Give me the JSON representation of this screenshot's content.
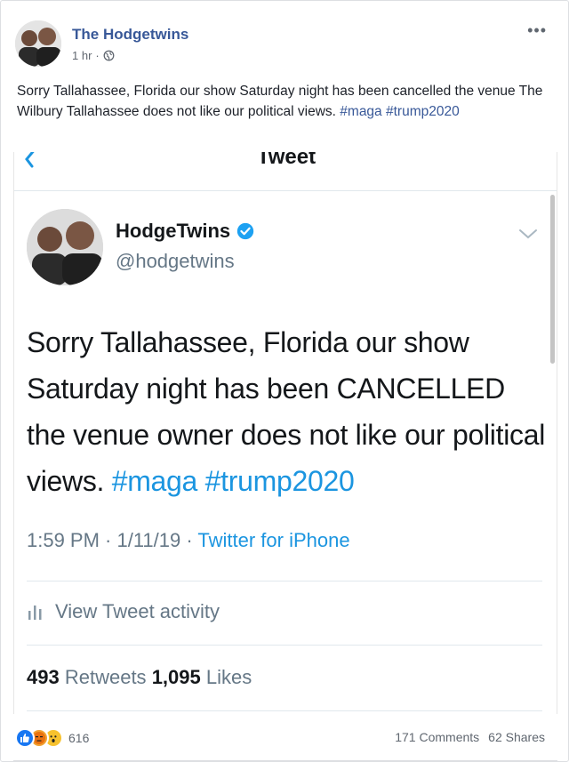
{
  "post": {
    "page_name": "The Hodgetwins",
    "time": "1 hr",
    "separator": "·",
    "more_label": "•••",
    "caption_text": "Sorry Tallahassee, Florida our show Saturday night has been cancelled the venue The Wilbury Tallahassee does not like our political views.",
    "caption_tags": [
      "#maga",
      "#trump2020"
    ]
  },
  "tweet": {
    "nav_title": "Tweet",
    "display_name": "HodgeTwins",
    "handle": "@hodgetwins",
    "text": "Sorry Tallahassee, Florida our show Saturday night has been CANCELLED the venue owner does not like our political views.",
    "hashtags": [
      "#maga",
      "#trump2020"
    ],
    "timestamp": "1:59 PM · 1/11/19 · ",
    "source": "Twitter for iPhone",
    "activity_label": "View Tweet activity",
    "retweets_count": "493",
    "retweets_label": "Retweets",
    "likes_count": "1,095",
    "likes_label": "Likes"
  },
  "footer": {
    "reaction_count": "616",
    "comments": "171 Comments",
    "shares": "62 Shares"
  },
  "icons": {
    "globe": "globe-icon",
    "verified": "verified-badge-icon",
    "back": "chevron-left-icon",
    "caret": "chevron-down-icon",
    "activity": "bar-chart-icon"
  },
  "colors": {
    "facebook_link": "#385898",
    "twitter_blue": "#1b95e0",
    "twitter_gray": "#657786"
  }
}
